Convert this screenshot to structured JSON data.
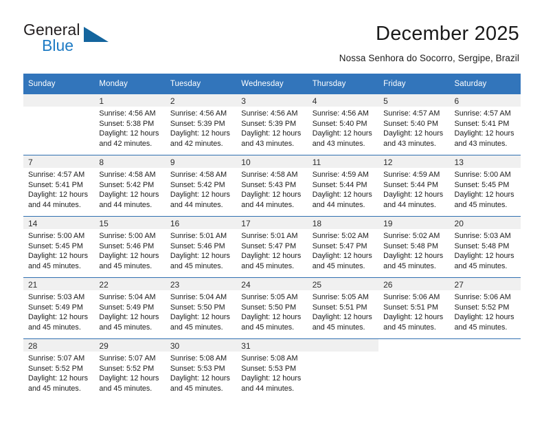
{
  "brand": {
    "name_top": "General",
    "name_bottom": "Blue",
    "triangle_color": "#14659e",
    "blue_text_color": "#1e7bc4"
  },
  "header": {
    "title": "December 2025",
    "subtitle": "Nossa Senhora do Socorro, Sergipe, Brazil"
  },
  "theme": {
    "header_blue": "#3275bb",
    "row_divider_blue": "#2f6fb0",
    "daynum_band": "#f0f0f0"
  },
  "weekdays": [
    "Sunday",
    "Monday",
    "Tuesday",
    "Wednesday",
    "Thursday",
    "Friday",
    "Saturday"
  ],
  "weeks": [
    [
      {
        "day": "",
        "lines": []
      },
      {
        "day": "1",
        "lines": [
          "Sunrise: 4:56 AM",
          "Sunset: 5:38 PM",
          "Daylight: 12 hours",
          "and 42 minutes."
        ]
      },
      {
        "day": "2",
        "lines": [
          "Sunrise: 4:56 AM",
          "Sunset: 5:39 PM",
          "Daylight: 12 hours",
          "and 42 minutes."
        ]
      },
      {
        "day": "3",
        "lines": [
          "Sunrise: 4:56 AM",
          "Sunset: 5:39 PM",
          "Daylight: 12 hours",
          "and 43 minutes."
        ]
      },
      {
        "day": "4",
        "lines": [
          "Sunrise: 4:56 AM",
          "Sunset: 5:40 PM",
          "Daylight: 12 hours",
          "and 43 minutes."
        ]
      },
      {
        "day": "5",
        "lines": [
          "Sunrise: 4:57 AM",
          "Sunset: 5:40 PM",
          "Daylight: 12 hours",
          "and 43 minutes."
        ]
      },
      {
        "day": "6",
        "lines": [
          "Sunrise: 4:57 AM",
          "Sunset: 5:41 PM",
          "Daylight: 12 hours",
          "and 43 minutes."
        ]
      }
    ],
    [
      {
        "day": "7",
        "lines": [
          "Sunrise: 4:57 AM",
          "Sunset: 5:41 PM",
          "Daylight: 12 hours",
          "and 44 minutes."
        ]
      },
      {
        "day": "8",
        "lines": [
          "Sunrise: 4:58 AM",
          "Sunset: 5:42 PM",
          "Daylight: 12 hours",
          "and 44 minutes."
        ]
      },
      {
        "day": "9",
        "lines": [
          "Sunrise: 4:58 AM",
          "Sunset: 5:42 PM",
          "Daylight: 12 hours",
          "and 44 minutes."
        ]
      },
      {
        "day": "10",
        "lines": [
          "Sunrise: 4:58 AM",
          "Sunset: 5:43 PM",
          "Daylight: 12 hours",
          "and 44 minutes."
        ]
      },
      {
        "day": "11",
        "lines": [
          "Sunrise: 4:59 AM",
          "Sunset: 5:44 PM",
          "Daylight: 12 hours",
          "and 44 minutes."
        ]
      },
      {
        "day": "12",
        "lines": [
          "Sunrise: 4:59 AM",
          "Sunset: 5:44 PM",
          "Daylight: 12 hours",
          "and 44 minutes."
        ]
      },
      {
        "day": "13",
        "lines": [
          "Sunrise: 5:00 AM",
          "Sunset: 5:45 PM",
          "Daylight: 12 hours",
          "and 45 minutes."
        ]
      }
    ],
    [
      {
        "day": "14",
        "lines": [
          "Sunrise: 5:00 AM",
          "Sunset: 5:45 PM",
          "Daylight: 12 hours",
          "and 45 minutes."
        ]
      },
      {
        "day": "15",
        "lines": [
          "Sunrise: 5:00 AM",
          "Sunset: 5:46 PM",
          "Daylight: 12 hours",
          "and 45 minutes."
        ]
      },
      {
        "day": "16",
        "lines": [
          "Sunrise: 5:01 AM",
          "Sunset: 5:46 PM",
          "Daylight: 12 hours",
          "and 45 minutes."
        ]
      },
      {
        "day": "17",
        "lines": [
          "Sunrise: 5:01 AM",
          "Sunset: 5:47 PM",
          "Daylight: 12 hours",
          "and 45 minutes."
        ]
      },
      {
        "day": "18",
        "lines": [
          "Sunrise: 5:02 AM",
          "Sunset: 5:47 PM",
          "Daylight: 12 hours",
          "and 45 minutes."
        ]
      },
      {
        "day": "19",
        "lines": [
          "Sunrise: 5:02 AM",
          "Sunset: 5:48 PM",
          "Daylight: 12 hours",
          "and 45 minutes."
        ]
      },
      {
        "day": "20",
        "lines": [
          "Sunrise: 5:03 AM",
          "Sunset: 5:48 PM",
          "Daylight: 12 hours",
          "and 45 minutes."
        ]
      }
    ],
    [
      {
        "day": "21",
        "lines": [
          "Sunrise: 5:03 AM",
          "Sunset: 5:49 PM",
          "Daylight: 12 hours",
          "and 45 minutes."
        ]
      },
      {
        "day": "22",
        "lines": [
          "Sunrise: 5:04 AM",
          "Sunset: 5:49 PM",
          "Daylight: 12 hours",
          "and 45 minutes."
        ]
      },
      {
        "day": "23",
        "lines": [
          "Sunrise: 5:04 AM",
          "Sunset: 5:50 PM",
          "Daylight: 12 hours",
          "and 45 minutes."
        ]
      },
      {
        "day": "24",
        "lines": [
          "Sunrise: 5:05 AM",
          "Sunset: 5:50 PM",
          "Daylight: 12 hours",
          "and 45 minutes."
        ]
      },
      {
        "day": "25",
        "lines": [
          "Sunrise: 5:05 AM",
          "Sunset: 5:51 PM",
          "Daylight: 12 hours",
          "and 45 minutes."
        ]
      },
      {
        "day": "26",
        "lines": [
          "Sunrise: 5:06 AM",
          "Sunset: 5:51 PM",
          "Daylight: 12 hours",
          "and 45 minutes."
        ]
      },
      {
        "day": "27",
        "lines": [
          "Sunrise: 5:06 AM",
          "Sunset: 5:52 PM",
          "Daylight: 12 hours",
          "and 45 minutes."
        ]
      }
    ],
    [
      {
        "day": "28",
        "lines": [
          "Sunrise: 5:07 AM",
          "Sunset: 5:52 PM",
          "Daylight: 12 hours",
          "and 45 minutes."
        ]
      },
      {
        "day": "29",
        "lines": [
          "Sunrise: 5:07 AM",
          "Sunset: 5:52 PM",
          "Daylight: 12 hours",
          "and 45 minutes."
        ]
      },
      {
        "day": "30",
        "lines": [
          "Sunrise: 5:08 AM",
          "Sunset: 5:53 PM",
          "Daylight: 12 hours",
          "and 45 minutes."
        ]
      },
      {
        "day": "31",
        "lines": [
          "Sunrise: 5:08 AM",
          "Sunset: 5:53 PM",
          "Daylight: 12 hours",
          "and 44 minutes."
        ]
      },
      {
        "day": "",
        "lines": []
      },
      {
        "day": "",
        "lines": [],
        "blank": true
      },
      {
        "day": "",
        "lines": [],
        "blank": true
      }
    ]
  ]
}
